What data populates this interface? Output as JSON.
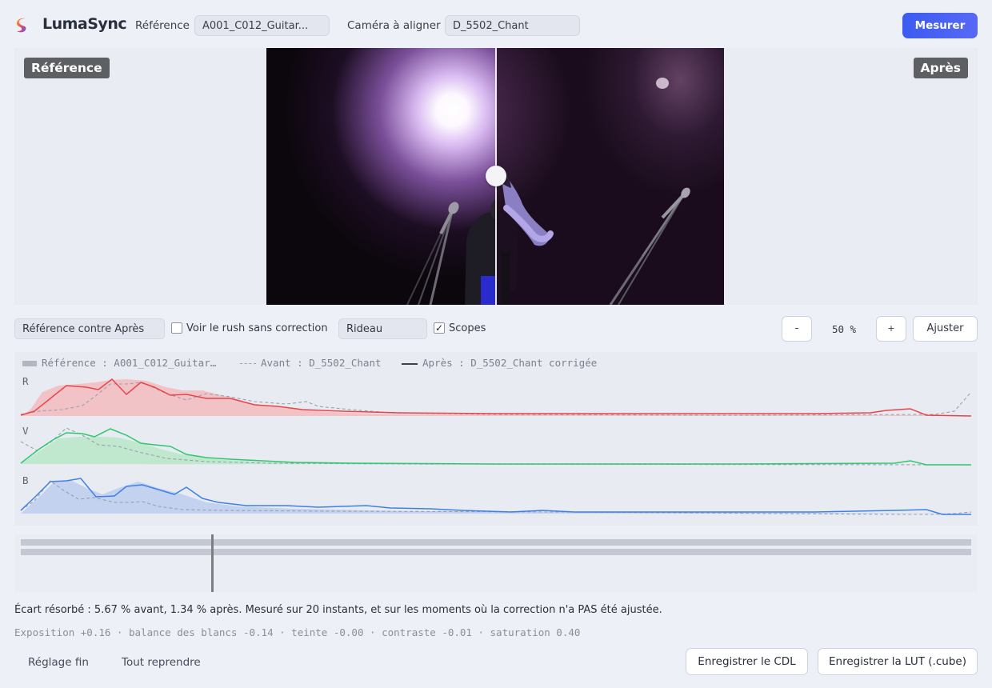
{
  "app": {
    "name": "LumaSync"
  },
  "header": {
    "reference_label": "Référence",
    "reference_value": "A001_C012_Guitar...",
    "camera_label": "Caméra à aligner",
    "camera_value": "D_5502_Chant",
    "measure_button": "Mesurer"
  },
  "viewer": {
    "left_label": "Référence",
    "right_label": "Après",
    "split_position_pct": 50
  },
  "toolbar": {
    "compare_select": "Référence contre Après",
    "raw_checkbox_label": "Voir le rush sans correction",
    "raw_checked": false,
    "mode_select": "Rideau",
    "scopes_checkbox_label": "Scopes",
    "scopes_checked": true,
    "check_mark": "✓",
    "zoom_out": "-",
    "zoom_value": "50 %",
    "zoom_in": "+",
    "fit_button": "Ajuster"
  },
  "scopes": {
    "legend": {
      "reference": "Référence : A001_C012_Guitar…",
      "before": "Avant : D_5502_Chant",
      "after": "Après : D_5502_Chant corrigée"
    },
    "channels": [
      {
        "key": "r",
        "label": "R",
        "color": "#e8454b",
        "fill": "#f2c3c6"
      },
      {
        "key": "v",
        "label": "V",
        "color": "#2fc76d",
        "fill": "#bfe8cf"
      },
      {
        "key": "b",
        "label": "B",
        "color": "#3f80e6",
        "fill": "#c2d2ef"
      }
    ]
  },
  "timeline": {
    "playhead_pct": 20
  },
  "summary": {
    "text": "Écart résorbé : 5.67 % avant, 1.34 % après. Mesuré sur 20 instants, et sur les moments où la correction n'a PAS été ajustée.",
    "params": "Exposition +0.16 · balance des blancs -0.14 · teinte -0.00 · contraste -0.01 · saturation 0.40"
  },
  "footer": {
    "fine_tune": "Réglage fin",
    "reset": "Tout reprendre",
    "save_cdl": "Enregistrer le CDL",
    "save_lut": "Enregistrer la LUT (.cube)"
  },
  "colors": {
    "accent": "#4a5ef2",
    "reference_swatch": "#b2b6c0",
    "before_line": "#9aa0ab",
    "after_line": "#3d424d"
  }
}
